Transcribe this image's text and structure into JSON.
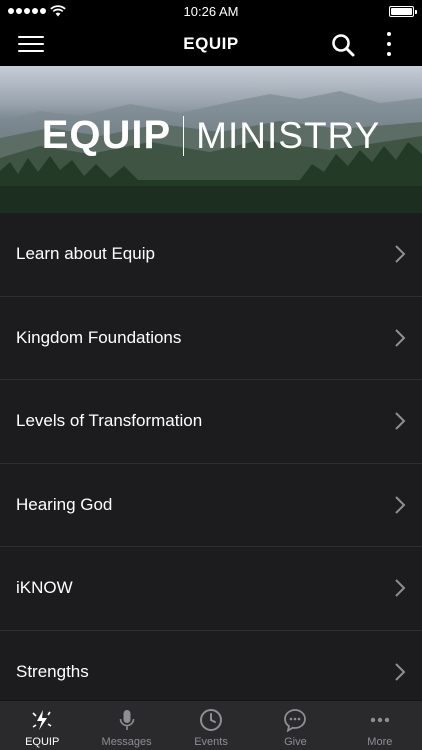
{
  "status_bar": {
    "time": "10:26 AM"
  },
  "nav": {
    "title": "EQUIP"
  },
  "banner": {
    "word1": "EQUIP",
    "word2": "MINISTRY"
  },
  "list": {
    "items": [
      {
        "label": "Learn about Equip"
      },
      {
        "label": "Kingdom Foundations"
      },
      {
        "label": "Levels of Transformation"
      },
      {
        "label": "Hearing God"
      },
      {
        "label": "iKNOW"
      },
      {
        "label": "Strengths"
      }
    ]
  },
  "tabs": [
    {
      "label": "EQUIP",
      "icon": "equip-icon",
      "active": true
    },
    {
      "label": "Messages",
      "icon": "microphone-icon",
      "active": false
    },
    {
      "label": "Events",
      "icon": "clock-icon",
      "active": false
    },
    {
      "label": "Give",
      "icon": "chat-bubble-icon",
      "active": false
    },
    {
      "label": "More",
      "icon": "more-dots-icon",
      "active": false
    }
  ],
  "colors": {
    "background": "#1c1c1e",
    "bar": "#000000",
    "tab_bar": "#2a2a2c",
    "inactive_tab": "#8e8e93"
  }
}
